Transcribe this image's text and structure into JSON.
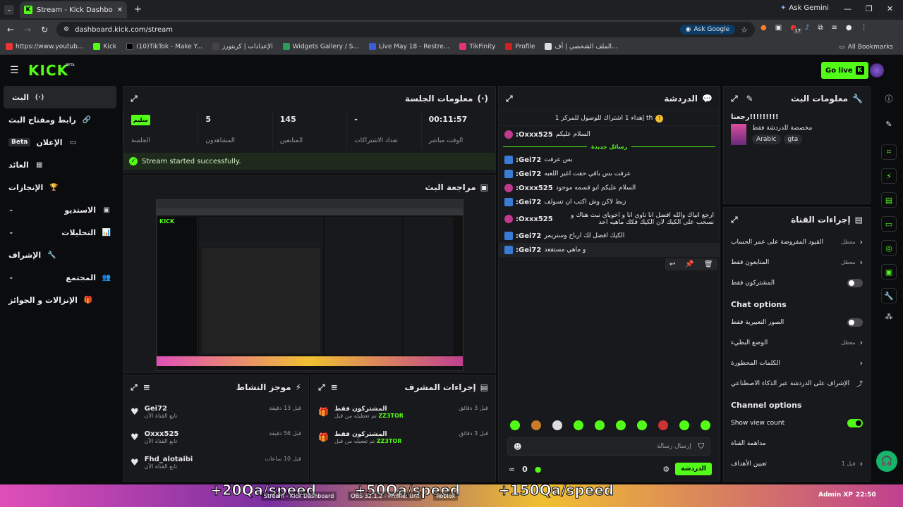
{
  "browser": {
    "tab_title": "Stream - Kick Dashboard",
    "ask_gemini": "Ask Gemini",
    "url": "dashboard.kick.com/stream",
    "ask_google": "Ask Google",
    "bookmarks": [
      "https://www.youtub...",
      "Kick",
      "(10)TikTok - Make Y...",
      "الإعدادات | كريتورز",
      "Widgets Gallery / S...",
      "Live May 18 - Restre...",
      "TikFinity",
      "Profile",
      "الملف الشخصي | أف..."
    ],
    "all_bookmarks": "All Bookmarks",
    "ext_badge": "17"
  },
  "kick": {
    "logo": "KICK",
    "logo_sup": "BETA",
    "go_live": "Go live"
  },
  "sidebar": {
    "items": [
      {
        "label": "البث",
        "icon": "(·)"
      },
      {
        "label": "رابط ومفتاح البث",
        "icon": "🔗"
      },
      {
        "label": "الإعلان",
        "icon": "▭",
        "badge": "Beta"
      },
      {
        "label": "العائد",
        "icon": "▦"
      },
      {
        "label": "الإنجازات",
        "icon": "🏆"
      },
      {
        "label": "الاستديو",
        "icon": "▣",
        "chev": true
      },
      {
        "label": "التحليلات",
        "icon": "📊",
        "chev": true
      },
      {
        "label": "الإشراف",
        "icon": "🔧"
      },
      {
        "label": "المجتمع",
        "icon": "👥",
        "chev": true
      },
      {
        "label": "الإنزالات و الجوائز",
        "icon": "🎁"
      }
    ]
  },
  "session": {
    "title": "معلومات الجلسة",
    "stats": [
      {
        "value": "00:11:57",
        "label": "الوقت مباشر"
      },
      {
        "value": "-",
        "label": "تعداد الاشتراكات"
      },
      {
        "value": "145",
        "label": "المتابعين"
      },
      {
        "value": "5",
        "label": "المشاهدون"
      },
      {
        "value": "سليم",
        "label": "الجلسة"
      }
    ],
    "success": "Stream started successfully.",
    "preview_title": "مراجعة البث"
  },
  "chat": {
    "title": "الدردشة",
    "pinned": "إهداء 1 اشتراك للوصول للمركز 1 th",
    "first": {
      "user": "Oxxx525:",
      "text": "السلام عليكم"
    },
    "new_messages": "رسائل جديدة",
    "messages": [
      {
        "user": "Gei72:",
        "text": "بس عرفت",
        "b": "blue"
      },
      {
        "user": "Gei72:",
        "text": "عرفت بس باقي حقت اغير اللعبه",
        "b": "blue"
      },
      {
        "user": "Oxxx525:",
        "text": "السلام عليكم ابو قسمه موجود",
        "b": "pink"
      },
      {
        "user": "Gei72:",
        "text": "زبط لاكن وش اكتب ان تسولف",
        "b": "blue"
      },
      {
        "user": "Oxxx525:",
        "text": "ارجع انياك والله افضل انا تاوي انا و اخوياي نبث هناك و نسحب على الكيك لان الكيك فكك ماهيه احد",
        "b": "pink"
      },
      {
        "user": "Gei72:",
        "text": "الكيك افضل لك ارباح وستريمر",
        "b": "blue"
      },
      {
        "user": "Gei72:",
        "text": "و ماهي مستقعد",
        "b": "blue"
      }
    ],
    "input_placeholder": "إرسال رسالة",
    "count": "0",
    "send": "الدردشة"
  },
  "stream_info": {
    "title": "معلومات البث",
    "stream_title": "رجعنا!!!!!!!!!",
    "category_sub": "مخصصة للدردشة فقط",
    "tags": [
      "Arabic",
      "gta"
    ]
  },
  "channel_actions": {
    "title": "إجراءات القناة",
    "rows": [
      {
        "label": "القيود المفروضة على عمر الحساب",
        "value": "معطل",
        "type": "chev"
      },
      {
        "label": "المتابعون فقط",
        "value": "معطل",
        "type": "chev"
      },
      {
        "label": "المشتركون فقط",
        "value": "",
        "type": "toggle-off"
      }
    ],
    "chat_options_title": "Chat options",
    "chat_rows": [
      {
        "label": "الصور التعبيرية فقط",
        "value": "",
        "type": "toggle-off"
      },
      {
        "label": "الوضع البطيء",
        "value": "معطل",
        "type": "chev"
      },
      {
        "label": "الكلمات المحظورة",
        "value": "",
        "type": "chev"
      },
      {
        "label": "الإشراف على الدردشة عبر الذكاء الاصطناعي",
        "value": "",
        "type": "ext"
      }
    ],
    "channel_options_title": "Channel options",
    "channel_rows": [
      {
        "label": "Show view count",
        "value": "",
        "type": "toggle-on"
      },
      {
        "label": "مداهمة القناة",
        "value": "",
        "type": "none"
      },
      {
        "label": "تعيين الأهداف",
        "value": "قبل 1",
        "type": "chev"
      }
    ]
  },
  "activity": {
    "title": "موجز النشاط",
    "items": [
      {
        "user": "Gei72",
        "sub": "تابع القناة الآن",
        "time": "قبل 13 دقيقة"
      },
      {
        "user": "Oxxx525",
        "sub": "تابع القناة الآن",
        "time": "قبل 56 دقيقة"
      },
      {
        "user": "Fhd_alotaibi",
        "sub": "تابع القناة الآن",
        "time": "قبل 10 ساعات"
      }
    ]
  },
  "mod_actions": {
    "title": "إجراءات المشرف",
    "items": [
      {
        "title": "المشتركون فقط",
        "sub": "تم تعطيله من قبل",
        "by": "ZZ3TOR",
        "time": "قبل 3 دقائق"
      },
      {
        "title": "المشتركون فقط",
        "sub": "تم تفعيله من قبل",
        "by": "ZZ3TOR",
        "time": "قبل 3 دقائق"
      }
    ]
  },
  "taskbar": {
    "banner": [
      "+20Qa/speed",
      "+50Qa/speed",
      "+150Qa/speed"
    ],
    "apps": [
      "Stream - Kick Dashboard",
      "OBS 32.1.2 - Profile: Unt",
      "Roblox"
    ],
    "user": "Admin XP",
    "clock": "22:50"
  },
  "colors": {
    "accent": "#53fc18",
    "panel": "#18191c",
    "bg": "#0b0c0e"
  }
}
